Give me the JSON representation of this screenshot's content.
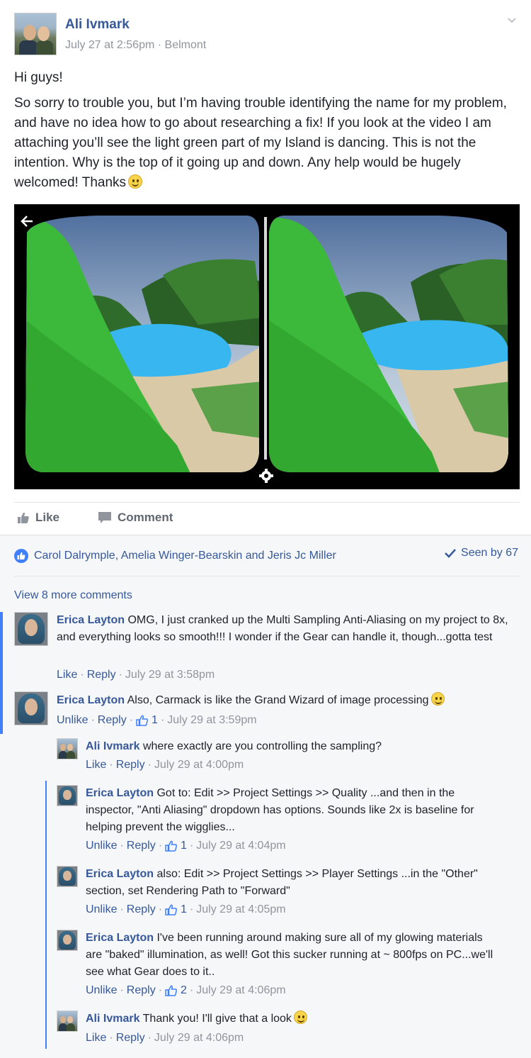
{
  "post": {
    "author": "Ali Ivmark",
    "timestamp": "July 27 at 2:56pm",
    "location": "Belmont",
    "meta_sep": " · ",
    "greeting": "Hi guys!",
    "body": "So sorry to trouble you, but I’m having trouble identifying the name for my problem, and have no idea how to go about researching a fix! If you look at the video I am attaching you’ll see the light green part of my Island is dancing. This is not the intention. Why is the top of it going up and down. Any help would be hugely welcomed! Thanks",
    "emoji": "smiley"
  },
  "actions": {
    "like_label": "Like",
    "comment_label": "Comment"
  },
  "reactions": {
    "names": "Carol Dalrymple, Amelia Winger-Bearskin and Jeris Jc Miller",
    "seen_label": "Seen by 67"
  },
  "view_more": "View 8 more comments",
  "comments": [
    {
      "author": "Erica Layton",
      "text": "OMG, I just cranked up the Multi Sampling Anti-Aliasing on my project to 8x, and everything looks so smooth!!! I wonder if the Gear can handle it, though...gotta test",
      "action1": "Like",
      "action2": "Reply",
      "likes": "",
      "time": "July 29 at 3:58pm"
    },
    {
      "author": "Erica Layton",
      "text": "Also, Carmack is like the Grand Wizard of image processing",
      "action1": "Unlike",
      "action2": "Reply",
      "likes": "1",
      "time": "July 29 at 3:59pm"
    }
  ],
  "replies": [
    {
      "author": "Ali Ivmark",
      "text": "where exactly are you controlling the sampling?",
      "action1": "Like",
      "action2": "Reply",
      "likes": "",
      "time": "July 29 at 4:00pm"
    },
    {
      "author": "Erica Layton",
      "text": "Got to: Edit >> Project Settings >> Quality ...and then in the inspector, \"Anti Aliasing\" dropdown has options. Sounds like 2x is baseline for helping prevent the wigglies...",
      "action1": "Unlike",
      "action2": "Reply",
      "likes": "1",
      "time": "July 29 at 4:04pm"
    },
    {
      "author": "Erica Layton",
      "text": "also: Edit >> Project Settings >> Player Settings ...in the \"Other\" section, set Rendering Path to \"Forward\"",
      "action1": "Unlike",
      "action2": "Reply",
      "likes": "1",
      "time": "July 29 at 4:05pm"
    },
    {
      "author": "Erica Layton",
      "text": "I've been running around making sure all of my glowing materials are \"baked\" illumination, as well! Got this sucker running at ~ 800fps on PC...we'll see what Gear does to it..",
      "action1": "Unlike",
      "action2": "Reply",
      "likes": "2",
      "time": "July 29 at 4:06pm"
    },
    {
      "author": "Ali Ivmark",
      "text": "Thank you! I'll give that a look",
      "action1": "Like",
      "action2": "Reply",
      "likes": "",
      "time": "July 29 at 4:06pm"
    }
  ],
  "colors": {
    "link_blue": "#365899",
    "meta_gray": "#90949c",
    "thread_accent": "#4080ff",
    "island_green": "#3cb83a",
    "water_blue": "#37b6ef"
  }
}
